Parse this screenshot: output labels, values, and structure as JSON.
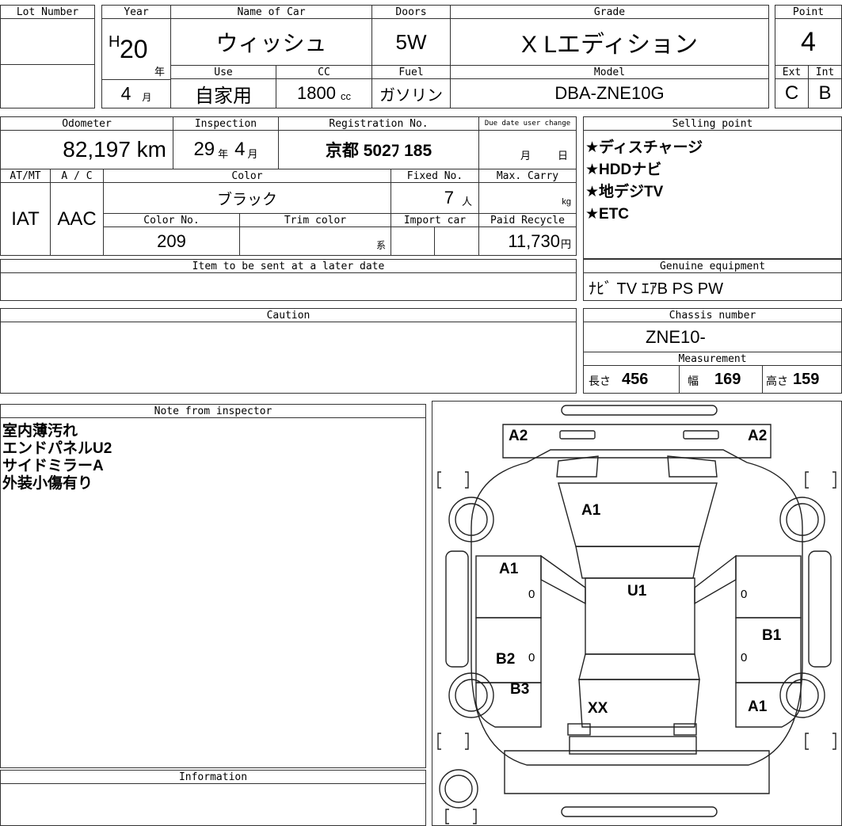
{
  "header": {
    "lot_number_label": "Lot Number",
    "year_label": "Year",
    "name_label": "Name of Car",
    "doors_label": "Doors",
    "grade_label": "Grade",
    "point_label": "Point",
    "use_label": "Use",
    "cc_label": "CC",
    "fuel_label": "Fuel",
    "model_label": "Model",
    "ext_label": "Ext",
    "int_label": "Int"
  },
  "vehicle": {
    "era_prefix": "H",
    "year": "20",
    "year_unit": "年",
    "month": "4",
    "month_unit": "月",
    "name": "ウィッシュ",
    "doors": "5W",
    "grade": "X Lエディション",
    "point": "4",
    "use": "自家用",
    "cc": "1800",
    "cc_unit": "cc",
    "fuel": "ガソリン",
    "model": "DBA-ZNE10G",
    "ext_grade": "C",
    "int_grade": "B"
  },
  "details_labels": {
    "odometer": "Odometer",
    "inspection": "Inspection",
    "registration": "Registration No.",
    "due_date": "Due date user change",
    "selling_point": "Selling point",
    "atmt": "AT/MT",
    "ac": "A / C",
    "color": "Color",
    "fixed_no": "Fixed No.",
    "max_carry": "Max. Carry",
    "color_no": "Color No.",
    "trim_color": "Trim color",
    "import_car": "Import car",
    "paid_recycle": "Paid Recycle",
    "later_date": "Item to be sent at a later date",
    "genuine": "Genuine equipment",
    "caution": "Caution",
    "chassis": "Chassis number",
    "measurement": "Measurement",
    "note": "Note from inspector",
    "information": "Information"
  },
  "details": {
    "odometer": "82,197 km",
    "inspection_year": "29",
    "inspection_year_unit": "年",
    "inspection_month": "4",
    "inspection_month_unit": "月",
    "registration": "京都 502ﾌ 185",
    "due_month_unit": "月",
    "due_day_unit": "日",
    "atmt": "IAT",
    "ac": "AAC",
    "color": "ブラック",
    "fixed_no": "7",
    "fixed_unit": "人",
    "max_carry_unit": "kg",
    "color_no": "209",
    "trim_unit": "系",
    "paid_recycle": "11,730",
    "paid_recycle_unit": "円",
    "genuine": "ﾅﾋﾞ TV ｴｱB PS PW",
    "chassis": "ZNE10-",
    "length_label": "長さ",
    "length": "456",
    "width_label": "幅",
    "width": "169",
    "height_label": "高さ",
    "height": "159"
  },
  "selling_points": [
    "★ディスチャージ",
    "★HDDナビ",
    "★地デジTV",
    "★ETC"
  ],
  "inspector_notes": [
    "室内薄汚れ",
    "エンドパネルU2",
    "サイドミラーA",
    "外装小傷有り"
  ],
  "diagram_marks": {
    "front_left_corner": "A2",
    "front_right_corner": "A2",
    "hood": "A1",
    "front_left_door": "A1",
    "front_left_door_zero": "0",
    "roof": "U1",
    "front_right_door_zero": "0",
    "rear_right_door": "B1",
    "rear_right_door_zero": "0",
    "rear_left_door": "B2",
    "rear_left_door_zero": "0",
    "rear_left_quarter": "B3",
    "trunk": "XX",
    "rear_right_quarter": "A1"
  }
}
